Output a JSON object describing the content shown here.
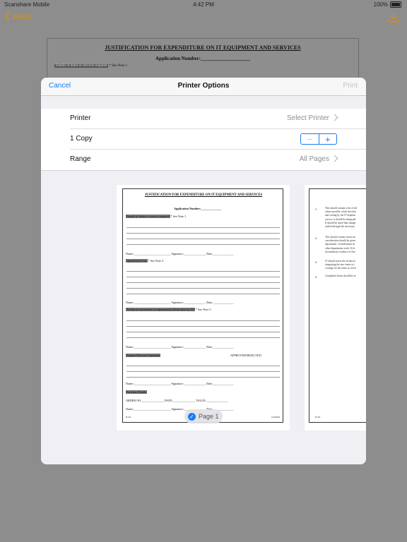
{
  "status_bar": {
    "carrier": "Scanshare Mobile",
    "time": "4:42 PM",
    "battery": "100%"
  },
  "nav": {
    "back_label": "Back"
  },
  "background_doc": {
    "title": "JUSTIFICATION FOR EXPENDITURE ON IT EQUIPMENT AND SERVICES",
    "app_number": "Application Number:____________________",
    "details": "Details of items or services required",
    "see_note": "* See Note 1"
  },
  "modal": {
    "cancel_label": "Cancel",
    "title": "Printer Options",
    "print_label": "Print",
    "printer_label": "Printer",
    "printer_value": "Select Printer",
    "copies_label": "1 Copy",
    "range_label": "Range",
    "range_value": "All Pages",
    "page_badge": "Page 1",
    "colors": {
      "accent": "#1a7df2",
      "disabled": "#c4c4c6"
    }
  },
  "page1": {
    "title": "JUSTIFICATION FOR EXPENDITURE ON IT EQUIPMENT AND SERVICES",
    "app_number": "Application Number:______________",
    "details": "Details of items or services required",
    "see_note1": "* See Note 1",
    "name_line1": "Name:_________________________   Signature:_______________   Date:______________",
    "operational_cost": "Operational Cost",
    "see_note2": "* See Note 2",
    "name_line2": "Name:_________________________   Signature:_______________   Date:______________",
    "technical": "Technical assessment of requirements (To be done by IT)",
    "see_note3": "* See Note 3",
    "name_line3": "Name:_________________________   Signature:_______________   Date:______________",
    "finance": "Finance Director Comments",
    "approved": "APPROVED/REJECTED",
    "name_line4": "Name:_________________________   Signature:_______________   Date:______________",
    "purchase": "Purchase Details",
    "order_line": "ORDER NO:_______________       DATE:_______________       VALUE: ______________",
    "name_line5": "Name:_________________________   Signature:_______________   Date:______________",
    "footer_left": "IC/01",
    "footer_right": "12/06/04"
  },
  "page2": {
    "items": [
      {
        "num": "1.",
        "lines": [
          "This should contain a list of the",
          "where possible, relate the item",
          "and costing by the IT departm",
          "service, it should be adequatel",
          "It should be noted that change",
          "staffed through the necessary"
        ]
      },
      {
        "num": "2.",
        "lines": [
          "This should contain actual rea",
          "consideration should be given",
          "department. Consideration sh",
          "other departments work. If th",
          "documentary evidence of thes"
        ]
      },
      {
        "num": "3.",
        "lines": [
          "IT should assess the technical",
          "integrating the new items or i",
          "costings for the items or servic"
        ]
      },
      {
        "num": "4.",
        "lines": [
          "Completed forms should be se"
        ]
      }
    ],
    "footer_left": "IC/01"
  }
}
